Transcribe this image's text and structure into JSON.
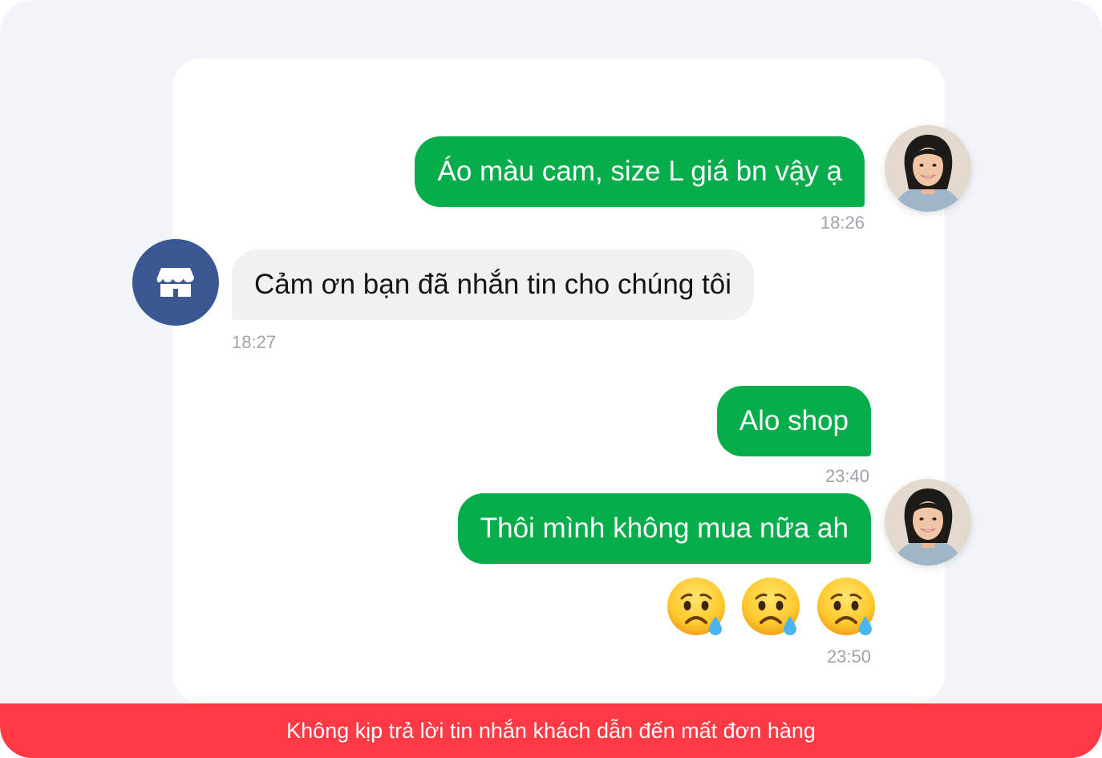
{
  "messages": [
    {
      "direction": "out",
      "text": "Áo màu cam, size L giá bn vậy ạ",
      "time": "18:26"
    },
    {
      "direction": "in",
      "text": "Cảm ơn bạn đã nhắn tin cho chúng tôi",
      "time": "18:27"
    },
    {
      "direction": "out",
      "text": "Alo shop",
      "time": "23:40"
    },
    {
      "direction": "out",
      "text": "Thôi mình không mua nữa ah",
      "time": "23:50"
    }
  ],
  "reaction": {
    "icon": "sad-crying-face-icon",
    "count": 3
  },
  "shop_avatar_icon": "storefront-icon",
  "customer_avatar": "customer-photo",
  "banner": {
    "text": "Không kịp trả lời tin nhắn khách dẫn đến mất đơn hàng"
  },
  "colors": {
    "outgoing_bubble": "#06ad4a",
    "incoming_bubble": "#f0f1f3",
    "shop_avatar": "#3a5794",
    "banner": "#ff3a45",
    "background": "#f1f5fa"
  }
}
